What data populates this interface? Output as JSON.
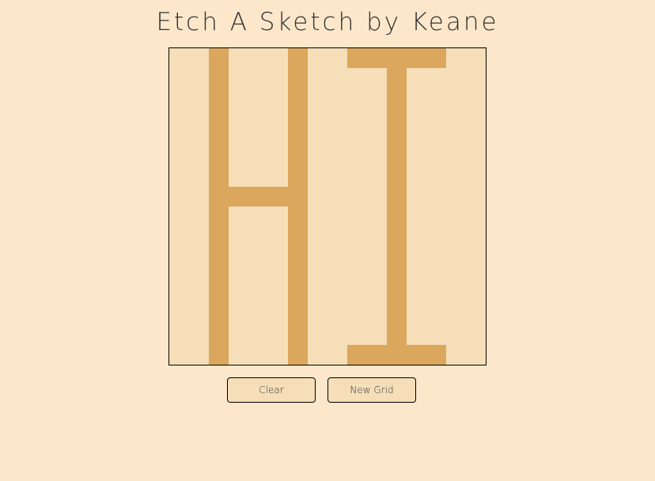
{
  "header": {
    "title": "Etch A Sketch by Keane"
  },
  "sketch_grid": {
    "columns": 16,
    "rows": 16,
    "background_color": "#f5deb8",
    "ink_color": "#dba75c",
    "filled_cells": [
      [
        2,
        0
      ],
      [
        6,
        0
      ],
      [
        9,
        0
      ],
      [
        10,
        0
      ],
      [
        11,
        0
      ],
      [
        12,
        0
      ],
      [
        13,
        0
      ],
      [
        2,
        1
      ],
      [
        6,
        1
      ],
      [
        11,
        1
      ],
      [
        2,
        2
      ],
      [
        6,
        2
      ],
      [
        11,
        2
      ],
      [
        2,
        3
      ],
      [
        6,
        3
      ],
      [
        11,
        3
      ],
      [
        2,
        4
      ],
      [
        6,
        4
      ],
      [
        11,
        4
      ],
      [
        2,
        5
      ],
      [
        6,
        5
      ],
      [
        11,
        5
      ],
      [
        2,
        6
      ],
      [
        6,
        6
      ],
      [
        11,
        6
      ],
      [
        2,
        7
      ],
      [
        3,
        7
      ],
      [
        4,
        7
      ],
      [
        5,
        7
      ],
      [
        6,
        7
      ],
      [
        11,
        7
      ],
      [
        2,
        8
      ],
      [
        6,
        8
      ],
      [
        11,
        8
      ],
      [
        2,
        9
      ],
      [
        6,
        9
      ],
      [
        11,
        9
      ],
      [
        2,
        10
      ],
      [
        6,
        10
      ],
      [
        11,
        10
      ],
      [
        2,
        11
      ],
      [
        6,
        11
      ],
      [
        11,
        11
      ],
      [
        2,
        12
      ],
      [
        6,
        12
      ],
      [
        11,
        12
      ],
      [
        2,
        13
      ],
      [
        6,
        13
      ],
      [
        11,
        13
      ],
      [
        2,
        14
      ],
      [
        6,
        14
      ],
      [
        11,
        14
      ],
      [
        2,
        15
      ],
      [
        6,
        15
      ],
      [
        9,
        15
      ],
      [
        10,
        15
      ],
      [
        11,
        15
      ],
      [
        12,
        15
      ],
      [
        13,
        15
      ]
    ]
  },
  "controls": {
    "clear_label": "Clear",
    "new_grid_label": "New Grid"
  }
}
